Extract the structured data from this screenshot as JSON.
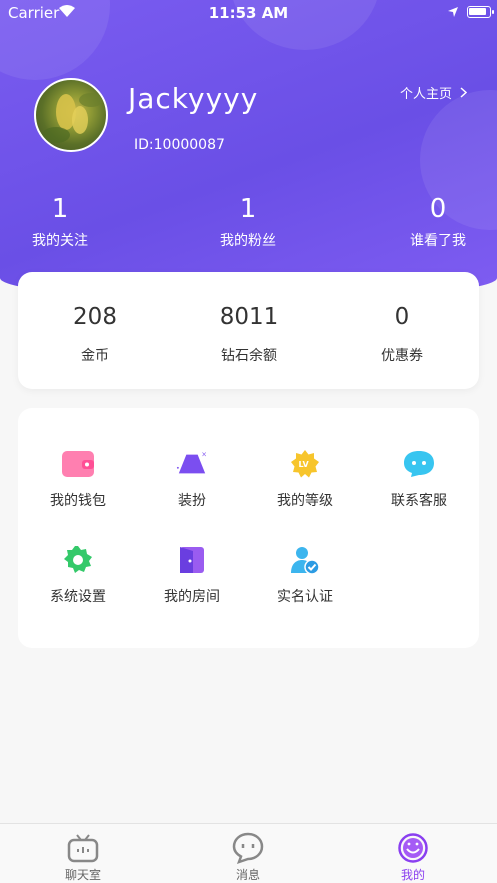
{
  "status_bar": {
    "carrier": "Carrier",
    "time": "11:53 AM"
  },
  "profile": {
    "username": "Jackyyyy",
    "user_id": "ID:10000087",
    "homepage_link": "个人主页",
    "social": [
      {
        "value": "1",
        "label": "我的关注"
      },
      {
        "value": "1",
        "label": "我的粉丝"
      },
      {
        "value": "0",
        "label": "谁看了我"
      }
    ]
  },
  "wallet": [
    {
      "value": "208",
      "label": "金币"
    },
    {
      "value": "8011",
      "label": "钻石余额"
    },
    {
      "value": "0",
      "label": "优惠券"
    }
  ],
  "menu": [
    {
      "label": "我的钱包",
      "icon": "wallet-icon"
    },
    {
      "label": "装扮",
      "icon": "dress-up-icon"
    },
    {
      "label": "我的等级",
      "icon": "level-icon"
    },
    {
      "label": "联系客服",
      "icon": "customer-service-icon"
    },
    {
      "label": "系统设置",
      "icon": "settings-icon"
    },
    {
      "label": "我的房间",
      "icon": "room-icon"
    },
    {
      "label": "实名认证",
      "icon": "verify-icon"
    }
  ],
  "tabs": [
    {
      "label": "聊天室",
      "icon": "tv-icon"
    },
    {
      "label": "消息",
      "icon": "chat-bubble-icon"
    },
    {
      "label": "我的",
      "icon": "smiley-icon"
    }
  ],
  "colors": {
    "header": "#6c50e8",
    "accent": "#8a3ff0"
  }
}
